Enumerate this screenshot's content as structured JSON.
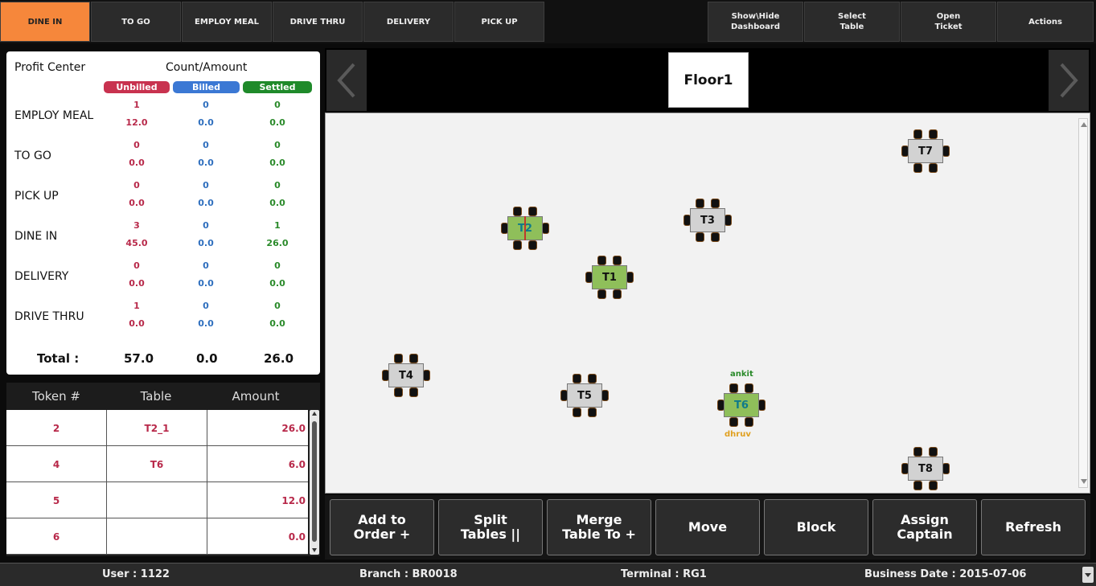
{
  "top_tabs": [
    {
      "label": "DINE IN"
    },
    {
      "label": "TO GO"
    },
    {
      "label": "EMPLOY MEAL"
    },
    {
      "label": "DRIVE THRU"
    },
    {
      "label": "DELIVERY"
    },
    {
      "label": "PICK UP"
    }
  ],
  "top_actions": [
    {
      "label": "Show\\Hide\nDashboard"
    },
    {
      "label": "Select\nTable"
    },
    {
      "label": "Open\nTicket"
    },
    {
      "label": "Actions"
    }
  ],
  "summary": {
    "profit_center_label": "Profit Center",
    "count_amount_label": "Count/Amount",
    "unbilled_label": "Unbilled",
    "billed_label": "Billed",
    "settled_label": "Settled",
    "rows": [
      {
        "name": "EMPLOY MEAL",
        "unbilled_count": "1",
        "unbilled_amount": "12.0",
        "billed_count": "0",
        "billed_amount": "0.0",
        "settled_count": "0",
        "settled_amount": "0.0"
      },
      {
        "name": "TO GO",
        "unbilled_count": "0",
        "unbilled_amount": "0.0",
        "billed_count": "0",
        "billed_amount": "0.0",
        "settled_count": "0",
        "settled_amount": "0.0"
      },
      {
        "name": "PICK UP",
        "unbilled_count": "0",
        "unbilled_amount": "0.0",
        "billed_count": "0",
        "billed_amount": "0.0",
        "settled_count": "0",
        "settled_amount": "0.0"
      },
      {
        "name": "DINE IN",
        "unbilled_count": "3",
        "unbilled_amount": "45.0",
        "billed_count": "0",
        "billed_amount": "0.0",
        "settled_count": "1",
        "settled_amount": "26.0"
      },
      {
        "name": "DELIVERY",
        "unbilled_count": "0",
        "unbilled_amount": "0.0",
        "billed_count": "0",
        "billed_amount": "0.0",
        "settled_count": "0",
        "settled_amount": "0.0"
      },
      {
        "name": "DRIVE THRU",
        "unbilled_count": "1",
        "unbilled_amount": "0.0",
        "billed_count": "0",
        "billed_amount": "0.0",
        "settled_count": "0",
        "settled_amount": "0.0"
      }
    ],
    "total_label": "Total :",
    "total_unbilled": "57.0",
    "total_billed": "0.0",
    "total_settled": "26.0",
    "colors": {
      "unbilled": "#c8324f",
      "billed": "#3b78d4",
      "settled": "#1f8a2a"
    }
  },
  "tokens": {
    "headers": [
      "Token #",
      "Table",
      "Amount"
    ],
    "rows": [
      {
        "token": "2",
        "table": "T2_1",
        "amount": "26.0"
      },
      {
        "token": "4",
        "table": "T6",
        "amount": "6.0"
      },
      {
        "token": "5",
        "table": "",
        "amount": "12.0"
      },
      {
        "token": "6",
        "table": "",
        "amount": "0.0"
      }
    ]
  },
  "floor": {
    "name": "Floor1",
    "tables": [
      {
        "label": "T7",
        "status": "free"
      },
      {
        "label": "T2",
        "status": "occupied"
      },
      {
        "label": "T3",
        "status": "free"
      },
      {
        "label": "T1",
        "status": "occupied"
      },
      {
        "label": "T4",
        "status": "free"
      },
      {
        "label": "T5",
        "status": "free"
      },
      {
        "label": "T6",
        "status": "occupied"
      },
      {
        "label": "T8",
        "status": "free"
      }
    ],
    "captains": [
      {
        "name": "ankit",
        "color": "#2a8a2a"
      },
      {
        "name": "dhruv",
        "color": "#e0a020"
      }
    ]
  },
  "actions": [
    {
      "label": "Add to\nOrder +"
    },
    {
      "label": "Split\nTables ||"
    },
    {
      "label": "Merge\nTable To +"
    },
    {
      "label": "Move"
    },
    {
      "label": "Block"
    },
    {
      "label": "Assign\nCaptain"
    },
    {
      "label": "Refresh"
    }
  ],
  "status_bar": {
    "user": "User : 1122",
    "branch": "Branch : BR0018",
    "terminal": "Terminal : RG1",
    "business_date": "Business Date : 2015-07-06"
  },
  "accent_color": "#f6873b"
}
